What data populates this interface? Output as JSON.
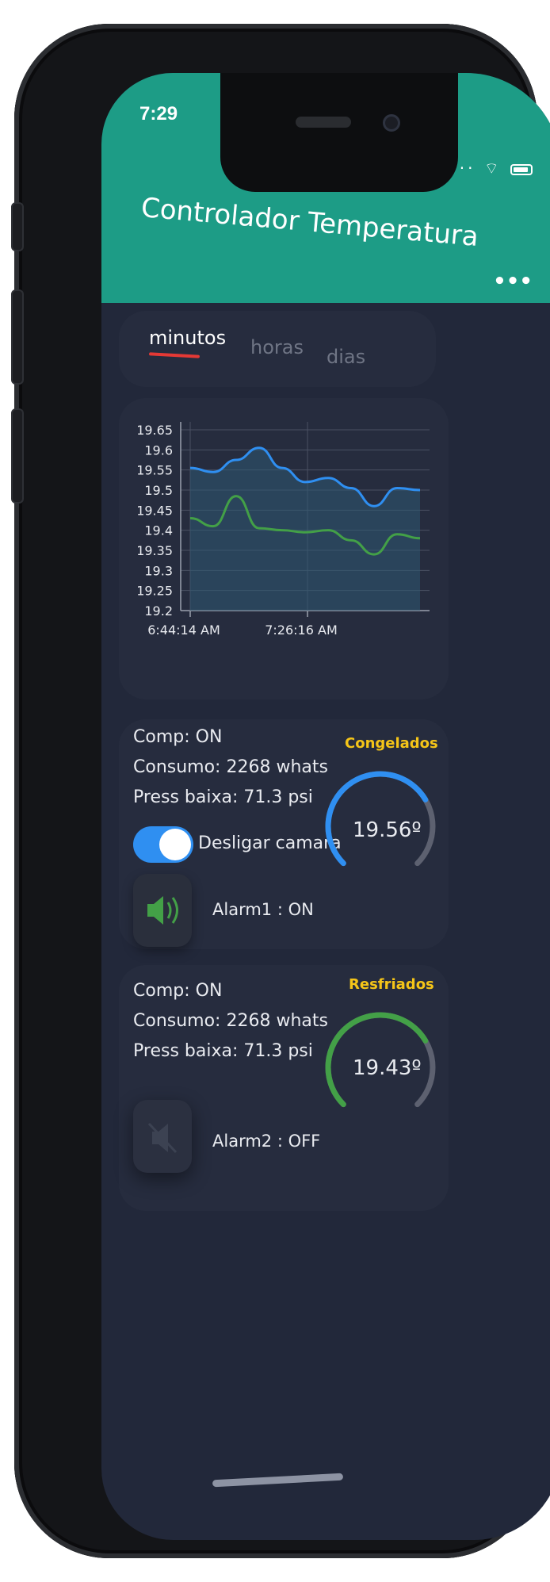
{
  "status_bar": {
    "time": "7:29"
  },
  "app_bar": {
    "title": "Controlador Temperatura",
    "menu": "•••"
  },
  "tabs": [
    {
      "label": "minutos",
      "active": true
    },
    {
      "label": "horas",
      "active": false
    },
    {
      "label": "dias",
      "active": false
    }
  ],
  "chart_data": {
    "type": "line",
    "x_tick_labels": [
      "6:44:14 AM",
      "7:26:16 AM"
    ],
    "y_tick_labels": [
      "19.65",
      "19.6",
      "19.55",
      "19.5",
      "19.45",
      "19.4",
      "19.35",
      "19.3",
      "19.25",
      "19.2"
    ],
    "ylim": [
      19.2,
      19.65
    ],
    "series": [
      {
        "color": "#2f8ff1",
        "values": [
          19.555,
          19.545,
          19.575,
          19.605,
          19.555,
          19.52,
          19.53,
          19.505,
          19.46,
          19.505,
          19.5
        ]
      },
      {
        "color": "#43a047",
        "values": [
          19.43,
          19.41,
          19.485,
          19.405,
          19.4,
          19.395,
          19.4,
          19.375,
          19.34,
          19.39,
          19.38
        ]
      }
    ],
    "grid": true
  },
  "devices": [
    {
      "comp": "Comp:  ON",
      "consumo": "Consumo:  2268 whats",
      "press": "Press baixa:  71.3 psi",
      "toggle_label": "Desligar camara",
      "toggle_on": true,
      "alarm_label": "Alarm1 : ON",
      "alarm_on": true,
      "gauge_title": "Congelados",
      "gauge_value": "19.56º",
      "gauge_color": "#2f8ff1",
      "gauge_fraction": 0.72
    },
    {
      "comp": "Comp:  ON",
      "consumo": "Consumo:  2268 whats",
      "press": "Press baixa:  71.3 psi",
      "alarm_label": "Alarm2 : OFF",
      "alarm_on": false,
      "gauge_title": "Resfriados",
      "gauge_value": "19.43º",
      "gauge_color": "#43a047",
      "gauge_fraction": 0.72
    }
  ],
  "colors": {
    "header": "#1d9c86",
    "background": "#22283a",
    "card": "#262c3e",
    "tab_indicator": "#e53935",
    "gauge_title": "#f5c518",
    "gauge_track": "#5d6170"
  }
}
